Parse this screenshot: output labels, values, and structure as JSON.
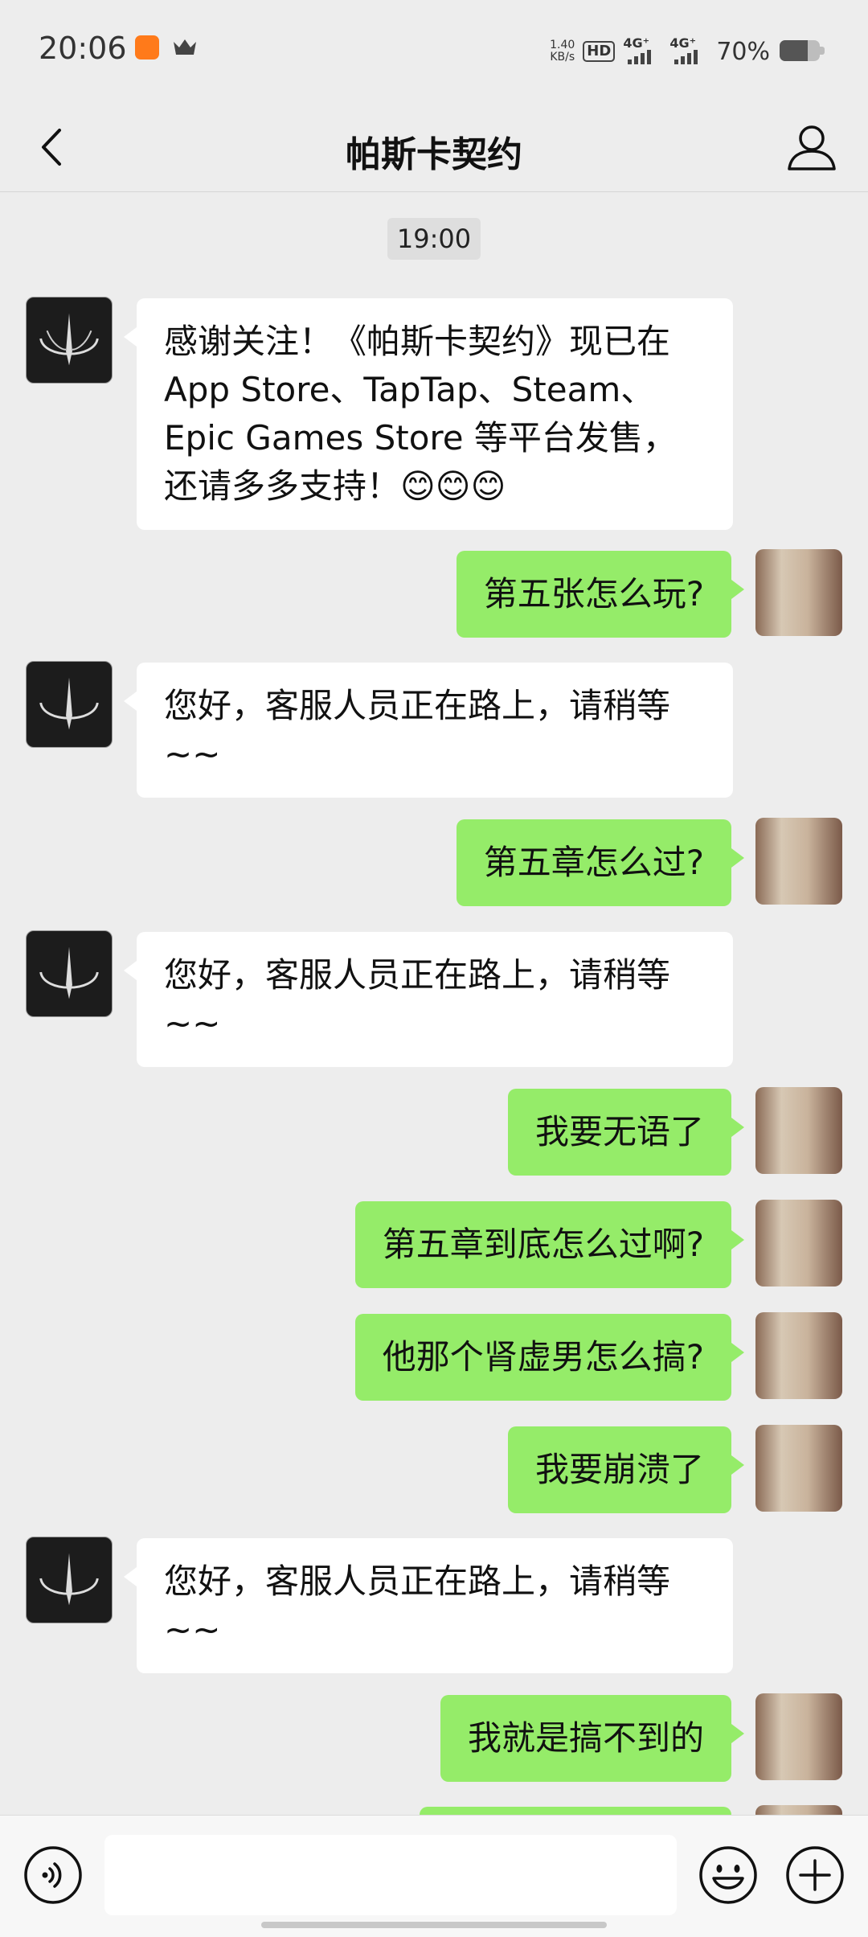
{
  "status_bar": {
    "time": "20:06",
    "speed_value": "1.40",
    "speed_unit": "KB/s",
    "hd_label": "HD",
    "network_1": "4G⁺",
    "network_2": "4G⁺",
    "battery_percent_text": "70%",
    "battery_level": 0.7
  },
  "header": {
    "title": "帕斯卡契约",
    "back_icon": "chevron-left-icon",
    "profile_icon": "person-icon"
  },
  "chat": {
    "timestamp": "19:00",
    "messages": [
      {
        "side": "in",
        "text": "感谢关注！《帕斯卡契约》现已在App Store、TapTap、Steam、Epic Games Store 等平台发售，还请多多支持！😊😊😊"
      },
      {
        "side": "out",
        "text": "第五张怎么玩?"
      },
      {
        "side": "in",
        "text": "您好，客服人员正在路上，请稍等~~"
      },
      {
        "side": "out",
        "text": "第五章怎么过?"
      },
      {
        "side": "in",
        "text": "您好，客服人员正在路上，请稍等~~"
      },
      {
        "side": "out",
        "text": "我要无语了"
      },
      {
        "side": "out",
        "text": "第五章到底怎么过啊?"
      },
      {
        "side": "out",
        "text": "他那个肾虚男怎么搞?"
      },
      {
        "side": "out",
        "text": "我要崩溃了"
      },
      {
        "side": "in",
        "text": "您好，客服人员正在路上，请稍等~~"
      },
      {
        "side": "out",
        "text": "我就是搞不到的"
      }
    ]
  },
  "input_bar": {
    "voice_icon": "voice-icon",
    "emoji_icon": "emoji-icon",
    "plus_icon": "plus-icon",
    "placeholder": ""
  },
  "colors": {
    "background": "#ededed",
    "outgoing_bubble": "#95ec69",
    "incoming_bubble": "#ffffff"
  }
}
